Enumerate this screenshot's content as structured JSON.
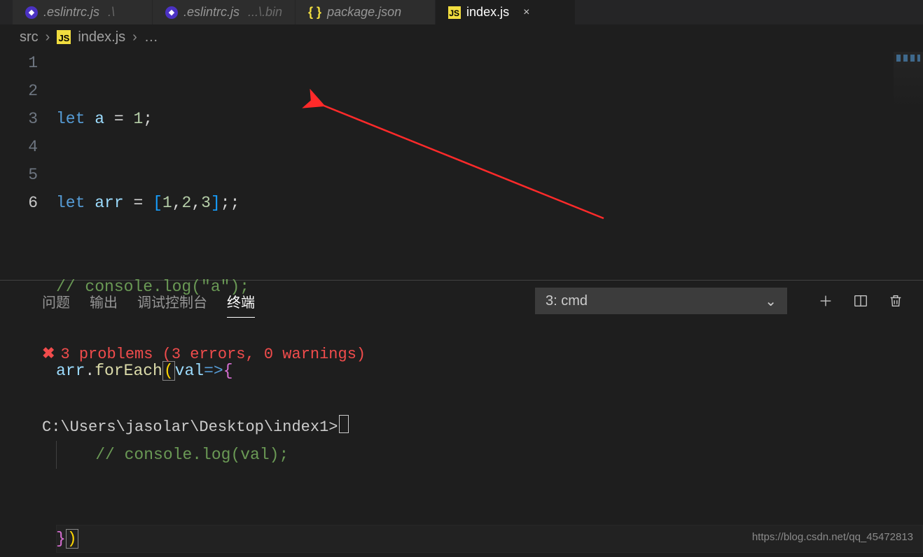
{
  "tabs": [
    {
      "icon": "eslint",
      "label": ".eslintrc.js",
      "suffix": ".\\",
      "active": false
    },
    {
      "icon": "eslint",
      "label": ".eslintrc.js",
      "suffix": "...\\.bin",
      "active": false
    },
    {
      "icon": "json",
      "label": "package.json",
      "suffix": "",
      "active": false
    },
    {
      "icon": "js",
      "label": "index.js",
      "suffix": "",
      "active": true
    }
  ],
  "breadcrumbs": {
    "seg0": "src",
    "seg1": "index.js",
    "ellipsis": "…"
  },
  "editor": {
    "lines": [
      "1",
      "2",
      "3",
      "4",
      "5",
      "6"
    ],
    "currentLine": 6,
    "code": {
      "l1": {
        "kw": "let",
        "var": "a",
        "eq": "=",
        "num": "1",
        "semi": ";"
      },
      "l2": {
        "kw": "let",
        "var": "arr",
        "eq": "=",
        "lb": "[",
        "n1": "1",
        "c": ",",
        "n2": "2",
        "n3": "3",
        "rb": "]",
        "semi": ";;"
      },
      "l3": {
        "cmt": "// console.log(\"a\");"
      },
      "l4": {
        "obj": "arr",
        "dot": ".",
        "fn": "forEach",
        "lp": "(",
        "arg": "val",
        "arrow": "=>",
        "lb": "{"
      },
      "l5": {
        "cmt": "// console.log(val);"
      },
      "l6": {
        "rb": "}",
        "rp": ")"
      }
    }
  },
  "panel": {
    "tabs": {
      "problems": "问题",
      "output": "输出",
      "debug": "调试控制台",
      "terminal": "终端"
    },
    "select": "3: cmd",
    "terminal": {
      "error_line": "3 problems (3 errors, 0 warnings)",
      "prompt": "C:\\Users\\jasolar\\Desktop\\index1>"
    }
  },
  "watermark": "https://blog.csdn.net/qq_45472813"
}
